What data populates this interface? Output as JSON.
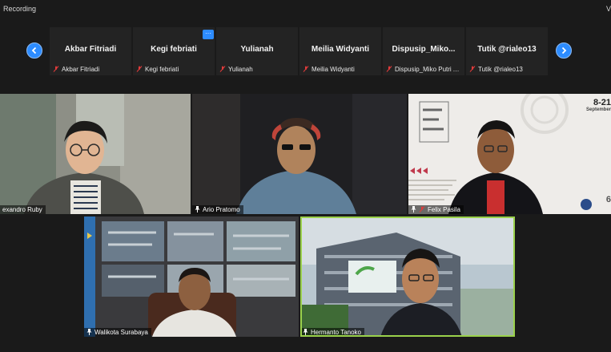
{
  "recording": {
    "label": "Recording"
  },
  "header": {
    "view_label": "V"
  },
  "strip": {
    "tiles": [
      {
        "name": "Akbar Fitriadi",
        "label": "Akbar Fitriadi"
      },
      {
        "name": "Kegi febriati",
        "label": "Kegi febriati"
      },
      {
        "name": "Yulianah",
        "label": "Yulianah"
      },
      {
        "name": "Meilia Widyanti",
        "label": "Meilia Widyanti"
      },
      {
        "name": "Dispusip_Miko...",
        "label": "Dispusip_Miko Putri A..."
      },
      {
        "name": "Tutik @rialeo13",
        "label": "Tutik @rialeo13"
      }
    ],
    "more_label": "···"
  },
  "videos": [
    {
      "label": "exandro Ruby"
    },
    {
      "label": "Ario Pratomo"
    },
    {
      "label": "Felix Pasila",
      "poster": {
        "date": "8-21",
        "month": "September",
        "side": "6"
      }
    },
    {
      "label": "Walikota Surabaya"
    },
    {
      "label": "Hermanto Tanoko"
    }
  ],
  "colors": {
    "accent": "#2d8cff",
    "active_speaker": "#9ad14b",
    "muted": "#e23b3b",
    "recording": "#e23b3b"
  }
}
